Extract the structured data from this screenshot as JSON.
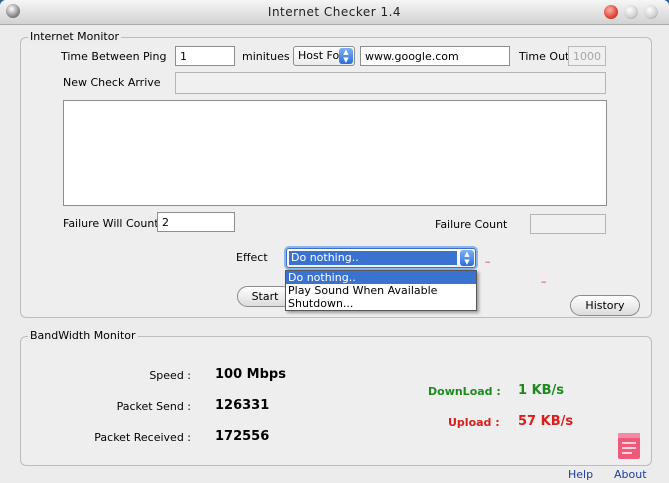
{
  "window": {
    "title": "Internet Checker 1.4"
  },
  "internet_monitor": {
    "group_label": "Internet Monitor",
    "time_between_ping_label": "Time Between Ping",
    "time_between_ping_value": "1",
    "minutes_label": "minitues",
    "host_select_value": "Host For",
    "host_value": "www.google.com",
    "timeout_label": "Time Out",
    "timeout_value": "1000",
    "new_check_arrive_label": "New Check Arrive",
    "failure_will_count_label": "Failure Will Count",
    "failure_will_count_value": "2",
    "failure_count_label": "Failure Count",
    "effect_label": "Effect",
    "effect_selected": "Do nothing..",
    "effect_options": [
      "Do nothing..",
      "Play Sound When Available",
      "Shutdown..."
    ],
    "start_button": "Start",
    "history_button": "History"
  },
  "bandwidth_monitor": {
    "group_label": "BandWidth Monitor",
    "speed_label": "Speed :",
    "speed_value": "100 Mbps",
    "packet_send_label": "Packet Send :",
    "packet_send_value": "126331",
    "packet_received_label": "Packet Received :",
    "packet_received_value": "172556",
    "download_label": "DownLoad :",
    "download_value": "1 KB/s",
    "upload_label": "Upload :",
    "upload_value": "57 KB/s"
  },
  "footer": {
    "help_link": "Help",
    "about_link": "About"
  },
  "colors": {
    "download": "#1e8a1e",
    "upload": "#d6201e",
    "selection": "#3a72d0",
    "link": "#1d3da0"
  },
  "icons": [
    "app-icon",
    "close-icon",
    "minimize-icon",
    "maximize-icon",
    "select-arrows-icon",
    "notes-icon"
  ]
}
